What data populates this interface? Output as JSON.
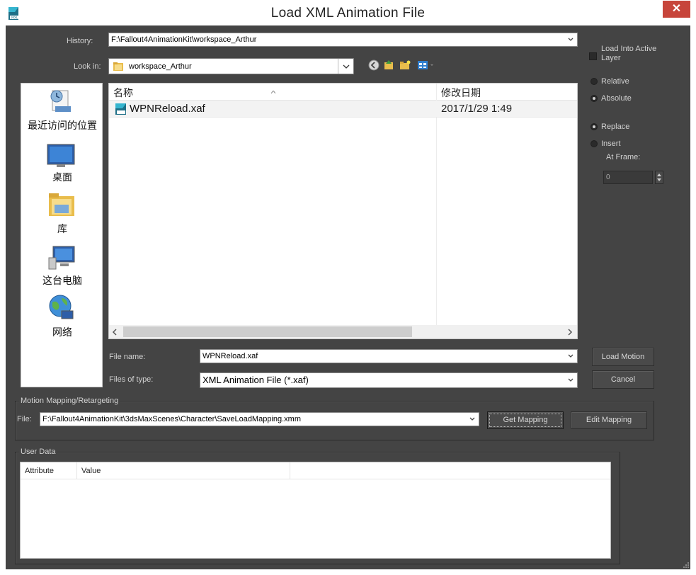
{
  "window": {
    "title": "Load XML Animation File",
    "close_glyph": "✕"
  },
  "history": {
    "label": "History:",
    "value": "F:\\Fallout4AnimationKit\\workspace_Arthur"
  },
  "lookin": {
    "label": "Look in:",
    "value": "workspace_Arthur"
  },
  "places": [
    {
      "label": "最近访问的位置",
      "icon": "recent-places-icon"
    },
    {
      "label": "桌面",
      "icon": "desktop-icon"
    },
    {
      "label": "库",
      "icon": "libraries-icon"
    },
    {
      "label": "这台电脑",
      "icon": "this-pc-icon"
    },
    {
      "label": "网络",
      "icon": "network-icon"
    }
  ],
  "filelist": {
    "columns": [
      "名称",
      "修改日期"
    ],
    "rows": [
      {
        "name": "WPNReload.xaf",
        "modified": "2017/1/29 1:49"
      }
    ]
  },
  "filename": {
    "label": "File name:",
    "value": "WPNReload.xaf"
  },
  "filetype": {
    "label": "Files of type:",
    "value": "XML Animation File (*.xaf)"
  },
  "buttons": {
    "load_motion": "Load Motion",
    "cancel": "Cancel",
    "get_mapping": "Get Mapping",
    "edit_mapping": "Edit Mapping"
  },
  "options": {
    "load_into_active_layer": "Load Into Active Layer",
    "relative": "Relative",
    "absolute": "Absolute",
    "replace": "Replace",
    "insert": "Insert",
    "at_frame_label": "At Frame:",
    "at_frame_value": "0"
  },
  "mapping": {
    "group_title": "Motion Mapping/Retargeting",
    "file_label": "File:",
    "file_value": "F:\\Fallout4AnimationKit\\3dsMaxScenes\\Character\\SaveLoadMapping.xmm"
  },
  "userdata": {
    "group_title": "User Data",
    "columns": [
      "Attribute",
      "Value"
    ]
  },
  "colors": {
    "dialog_bg": "#444444",
    "close_button": "#c7453b"
  }
}
